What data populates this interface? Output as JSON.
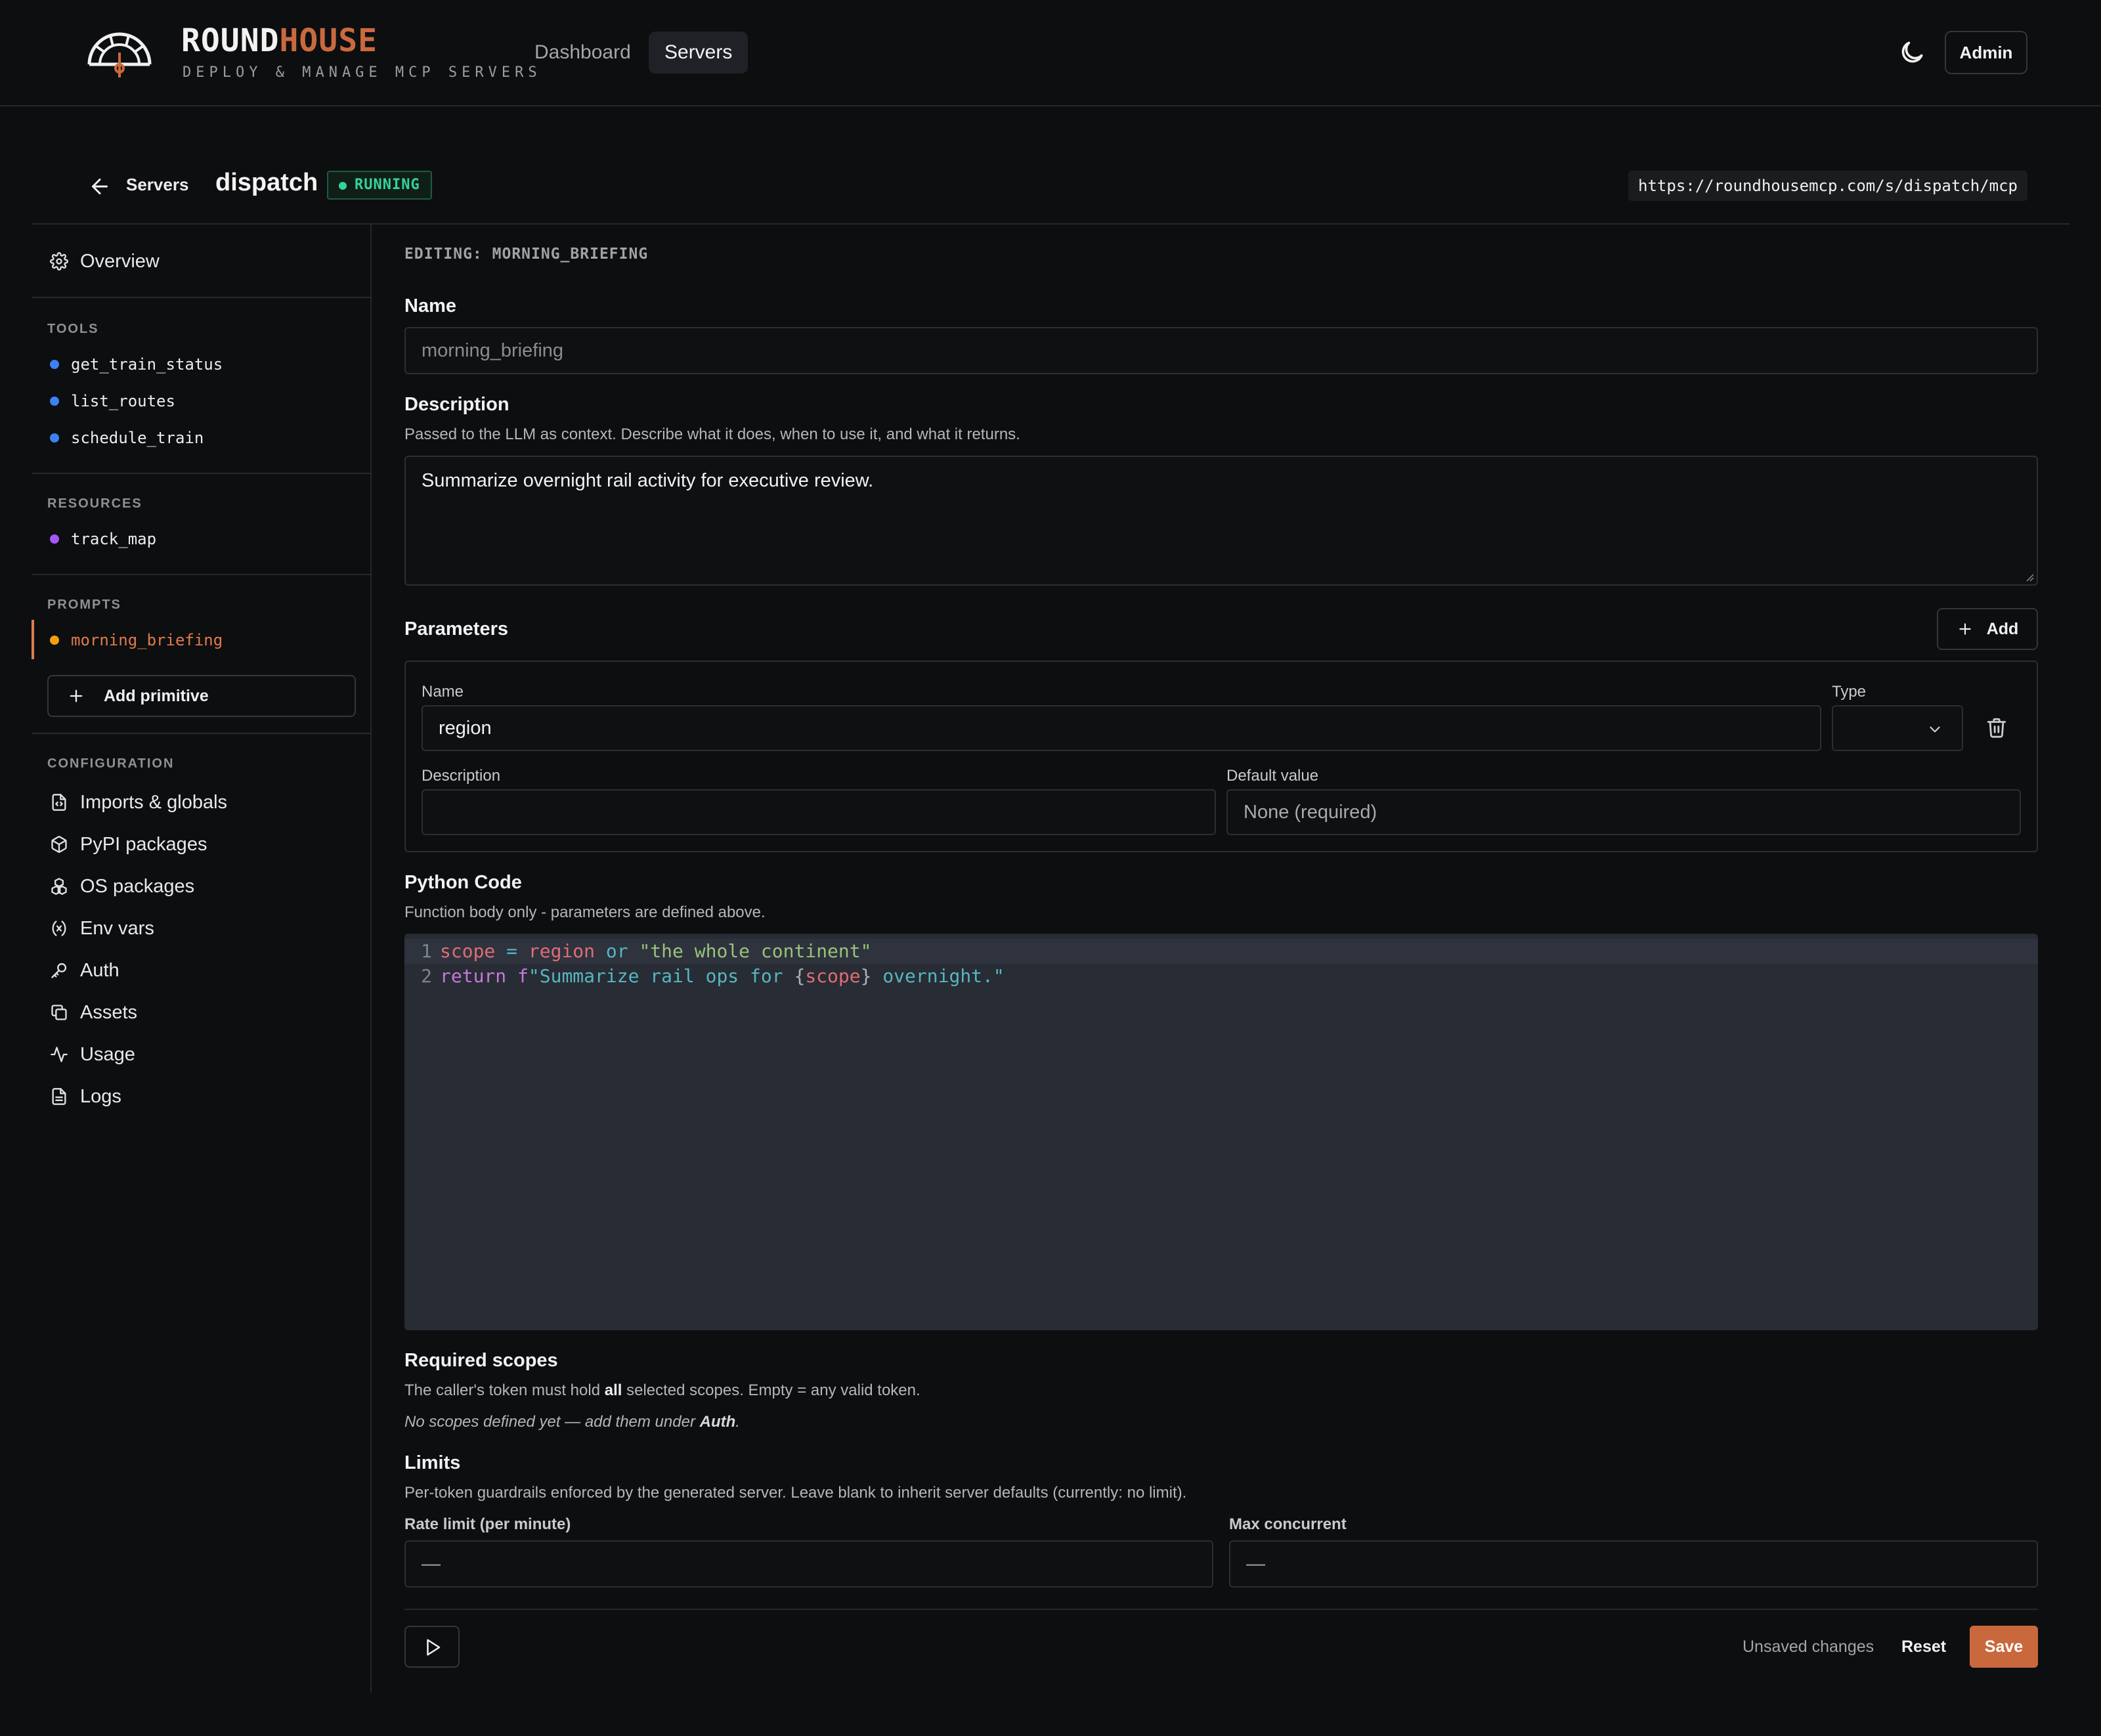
{
  "brand": {
    "name_main": "ROUND",
    "name_accent": "HOUSE",
    "tagline": "DEPLOY & MANAGE MCP SERVERS",
    "accent_color": "#c96a3e"
  },
  "nav": {
    "items": [
      {
        "label": "Dashboard",
        "active": false
      },
      {
        "label": "Servers",
        "active": true
      }
    ],
    "theme_icon": "moon-icon",
    "admin_label": "Admin"
  },
  "server": {
    "back_label": "Servers",
    "name": "dispatch",
    "status": "RUNNING",
    "status_color": "#34d399",
    "url": "https://roundhousemcp.com/s/dispatch/mcp"
  },
  "sidebar": {
    "overview": {
      "label": "Overview",
      "icon": "gear-icon"
    },
    "tools": {
      "heading": "TOOLS",
      "items": [
        "get_train_status",
        "list_routes",
        "schedule_train"
      ],
      "dot_color": "#3b82f6"
    },
    "resources": {
      "heading": "RESOURCES",
      "items": [
        "track_map"
      ],
      "dot_color": "#a855f7"
    },
    "prompts": {
      "heading": "PROMPTS",
      "items": [
        "morning_briefing"
      ],
      "dot_color": "#f59e0b",
      "active": "morning_briefing"
    },
    "add_primitive_label": "Add primitive",
    "configuration": {
      "heading": "CONFIGURATION",
      "items": [
        {
          "label": "Imports & globals",
          "icon": "file-code-icon"
        },
        {
          "label": "PyPI packages",
          "icon": "package-icon"
        },
        {
          "label": "OS packages",
          "icon": "boxes-icon"
        },
        {
          "label": "Env vars",
          "icon": "variable-icon"
        },
        {
          "label": "Auth",
          "icon": "key-icon"
        },
        {
          "label": "Assets",
          "icon": "copy-icon"
        },
        {
          "label": "Usage",
          "icon": "activity-icon"
        },
        {
          "label": "Logs",
          "icon": "file-text-icon"
        }
      ]
    }
  },
  "editor": {
    "editing_prefix": "EDITING: ",
    "editing_name": "MORNING_BRIEFING",
    "name_label": "Name",
    "name_value": "morning_briefing",
    "description_label": "Description",
    "description_help": "Passed to the LLM as context. Describe what it does, when to use it, and what it returns.",
    "description_value": "Summarize overnight rail activity for executive review.",
    "parameters_label": "Parameters",
    "add_label": "Add",
    "parameter": {
      "name_label": "Name",
      "name_value": "region",
      "type_label": "Type",
      "type_value": "",
      "description_label": "Description",
      "description_value": "",
      "default_label": "Default value",
      "default_placeholder": "None (required)"
    },
    "code_label": "Python Code",
    "code_help": "Function body only - parameters are defined above.",
    "code_lines": [
      "scope = region or \"the whole continent\"",
      "return f\"Summarize rail ops for {scope} overnight.\""
    ],
    "scopes_label": "Required scopes",
    "scopes_help_pre": "The caller's token must hold ",
    "scopes_help_bold": "all",
    "scopes_help_post": " selected scopes. Empty = any valid token.",
    "scopes_empty_pre": "No scopes defined yet — add them under ",
    "scopes_empty_bold": "Auth",
    "scopes_empty_post": ".",
    "limits_label": "Limits",
    "limits_help": "Per-token guardrails enforced by the generated server. Leave blank to inherit server defaults (currently: no limit).",
    "rate_limit_label": "Rate limit (per minute)",
    "rate_limit_placeholder": "—",
    "max_concurrent_label": "Max concurrent",
    "max_concurrent_placeholder": "—"
  },
  "footer": {
    "unsaved_label": "Unsaved changes",
    "reset_label": "Reset",
    "save_label": "Save",
    "save_color": "#c8683c"
  }
}
